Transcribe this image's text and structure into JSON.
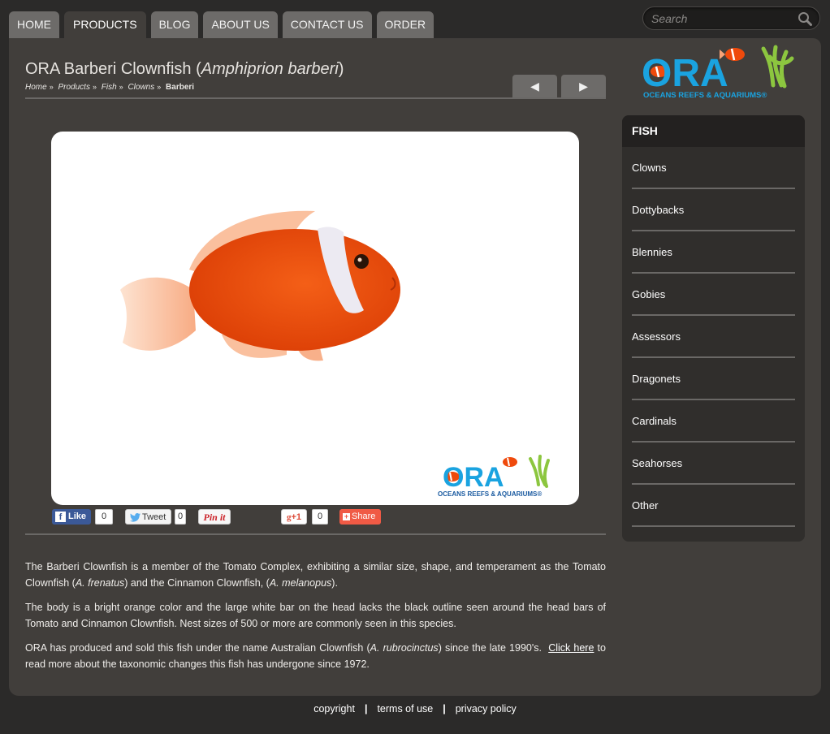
{
  "nav": {
    "tabs": [
      {
        "label": "HOME"
      },
      {
        "label": "PRODUCTS"
      },
      {
        "label": "BLOG"
      },
      {
        "label": "ABOUT US"
      },
      {
        "label": "CONTACT US"
      },
      {
        "label": "ORDER"
      }
    ],
    "active": "PRODUCTS"
  },
  "search": {
    "placeholder": "Search"
  },
  "page": {
    "title_main": "ORA Barberi Clownfish (",
    "title_sci": "Amphiprion barberi",
    "title_end": ")",
    "breadcrumb": {
      "home": "Home",
      "products": "Products",
      "fish": "Fish",
      "clowns": "Clowns",
      "current": "Barberi",
      "separator": "»"
    },
    "pager": {
      "prev": "◀",
      "next": "▶"
    }
  },
  "photo": {
    "logo_text": "ORA",
    "logo_sub": "OCEANS REEFS & AQUARIUMS®"
  },
  "share": {
    "like": "Like",
    "like_count": "0",
    "tweet": "Tweet",
    "tweet_count": "0",
    "pin": "Pin it",
    "gplus": "+1",
    "gplus_count": "0",
    "share": "Share"
  },
  "description": {
    "p1_a": "The Barberi Clownfish is a member of the Tomato Complex, exhibiting a similar size, shape, and temperament as the Tomato Clownfish (",
    "p1_b": "A. frenatus",
    "p1_c": ") and the Cinnamon Clownfish, (",
    "p1_d": "A. melanopus",
    "p1_e": ").",
    "p2": "The body is a bright orange color and the large white bar on the head lacks the black outline seen around the head bars of Tomato and Cinnamon Clownfish. Nest sizes of 500 or more are commonly seen in this species.",
    "p3_a": "ORA has produced and sold this fish under the name Australian Clownfish (",
    "p3_b": "A. rubrocinctus",
    "p3_c": ") since the late 1990's.  ",
    "p3_link": "Click here",
    "p3_d": " to read more about the taxonomic changes this fish has undergone since 1972."
  },
  "logo": {
    "text": "ORA",
    "sub": "OCEANS REEFS & AQUARIUMS®"
  },
  "sidebar": {
    "heading": "FISH",
    "items": [
      {
        "label": "Clowns"
      },
      {
        "label": "Dottybacks"
      },
      {
        "label": "Blennies"
      },
      {
        "label": "Gobies"
      },
      {
        "label": "Assessors"
      },
      {
        "label": "Dragonets"
      },
      {
        "label": "Cardinals"
      },
      {
        "label": "Seahorses"
      },
      {
        "label": "Other"
      }
    ]
  },
  "footer": {
    "copyright": "copyright",
    "terms": "terms of use",
    "privacy": "privacy policy",
    "sep": "|"
  },
  "colors": {
    "background": "#2b2a29",
    "panel": "#413e3b",
    "tab": "#6d6b69",
    "sidebar": "#302e2c",
    "ora_blue": "#1aa3e0",
    "ora_green": "#8cc63f",
    "fish_orange": "#ef4a0c"
  }
}
